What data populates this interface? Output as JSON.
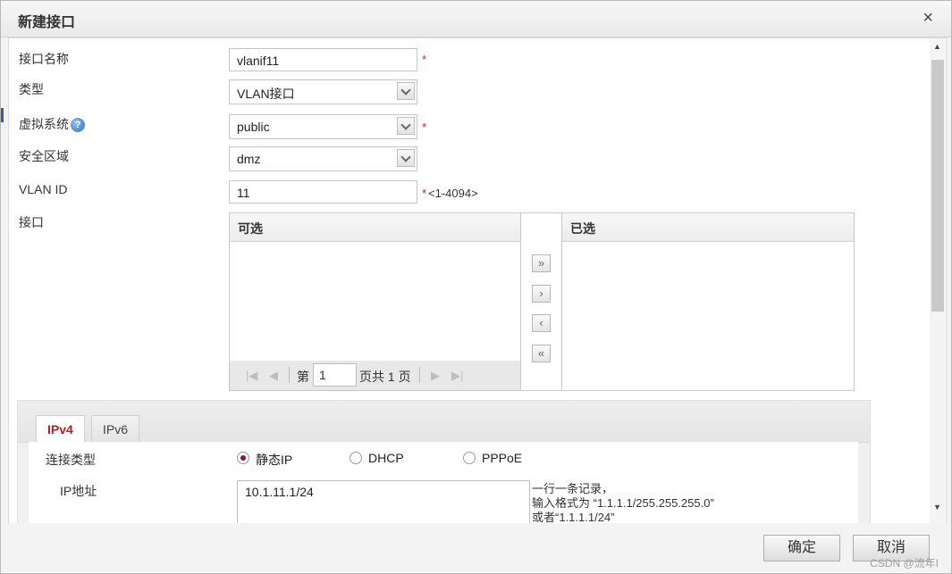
{
  "dialog": {
    "title": "新建接口",
    "close_glyph": "×"
  },
  "form": {
    "name_label": "接口名称",
    "name_value": "vlanif11",
    "type_label": "类型",
    "type_value": "VLAN接口",
    "vsys_label": "虚拟系统",
    "vsys_value": "public",
    "zone_label": "安全区域",
    "zone_value": "dmz",
    "vlan_label": "VLAN ID",
    "vlan_value": "11",
    "vlan_hint": "<1-4094>",
    "required_mark": "*",
    "help_glyph": "?",
    "iface_label": "接口"
  },
  "transfer": {
    "available_title": "可选",
    "selected_title": "已选",
    "pager": {
      "prefix": "第",
      "page_value": "1",
      "suffix": "页共 1 页"
    },
    "buttons": {
      "all_right": "»",
      "right": "›",
      "left": "‹",
      "all_left": "«"
    }
  },
  "ip": {
    "tabs": [
      "IPv4",
      "IPv6"
    ],
    "active_tab": "IPv4",
    "conn_label": "连接类型",
    "conn_options": [
      "静态IP",
      "DHCP",
      "PPPoE"
    ],
    "conn_selected": "静态IP",
    "addr_label": "IP地址",
    "addr_value": "10.1.11.1/24",
    "hint_line1": "一行一条记录，",
    "hint_line2": "输入格式为 “1.1.1.1/255.255.255.0”",
    "hint_line3": "或者“1.1.1.1/24”"
  },
  "footer": {
    "ok_label": "确定",
    "cancel_label": "取消",
    "watermark": "CSDN @流年I"
  },
  "colors": {
    "accent_red": "#b41d1d",
    "required_red": "#e02020"
  }
}
